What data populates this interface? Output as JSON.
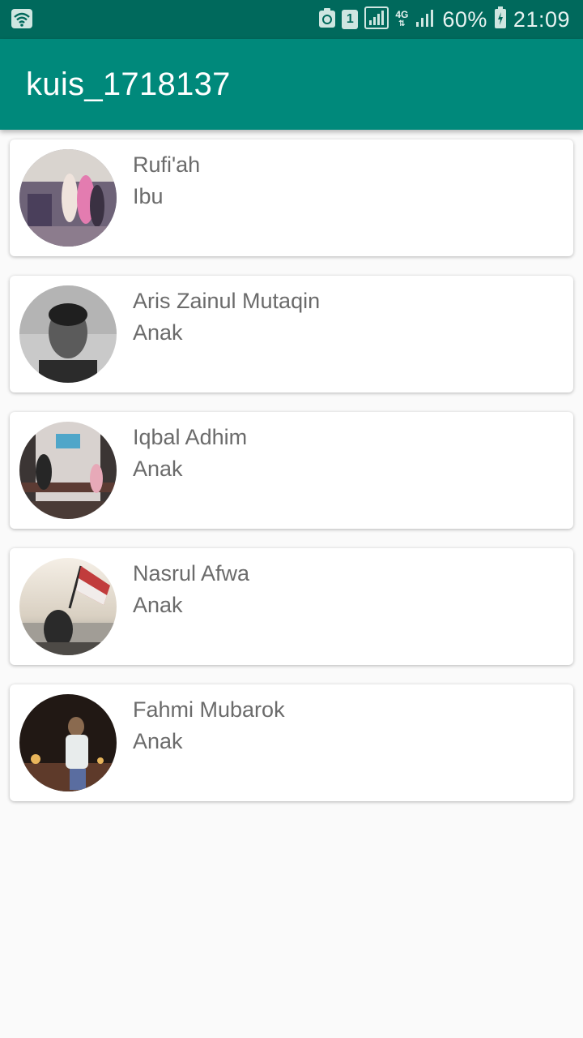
{
  "status_bar": {
    "sim_slot": "1",
    "network_type": "4G",
    "battery": "60%",
    "time": "21:09",
    "icons": [
      "wifi-icon",
      "recycle-icon",
      "sim-icon",
      "signal-icon",
      "battery-icon"
    ]
  },
  "app_bar": {
    "title": "kuis_1718137"
  },
  "contacts": [
    {
      "name": "Rufi'ah",
      "role": "Ibu"
    },
    {
      "name": "Aris Zainul Mutaqin",
      "role": "Anak"
    },
    {
      "name": "Iqbal Adhim",
      "role": "Anak"
    },
    {
      "name": "Nasrul Afwa",
      "role": "Anak"
    },
    {
      "name": "Fahmi Mubarok",
      "role": "Anak"
    }
  ],
  "colors": {
    "status_bar": "#00695c",
    "app_bar": "#00897b",
    "background": "#fafafa",
    "text_secondary": "#6b6b6b"
  }
}
